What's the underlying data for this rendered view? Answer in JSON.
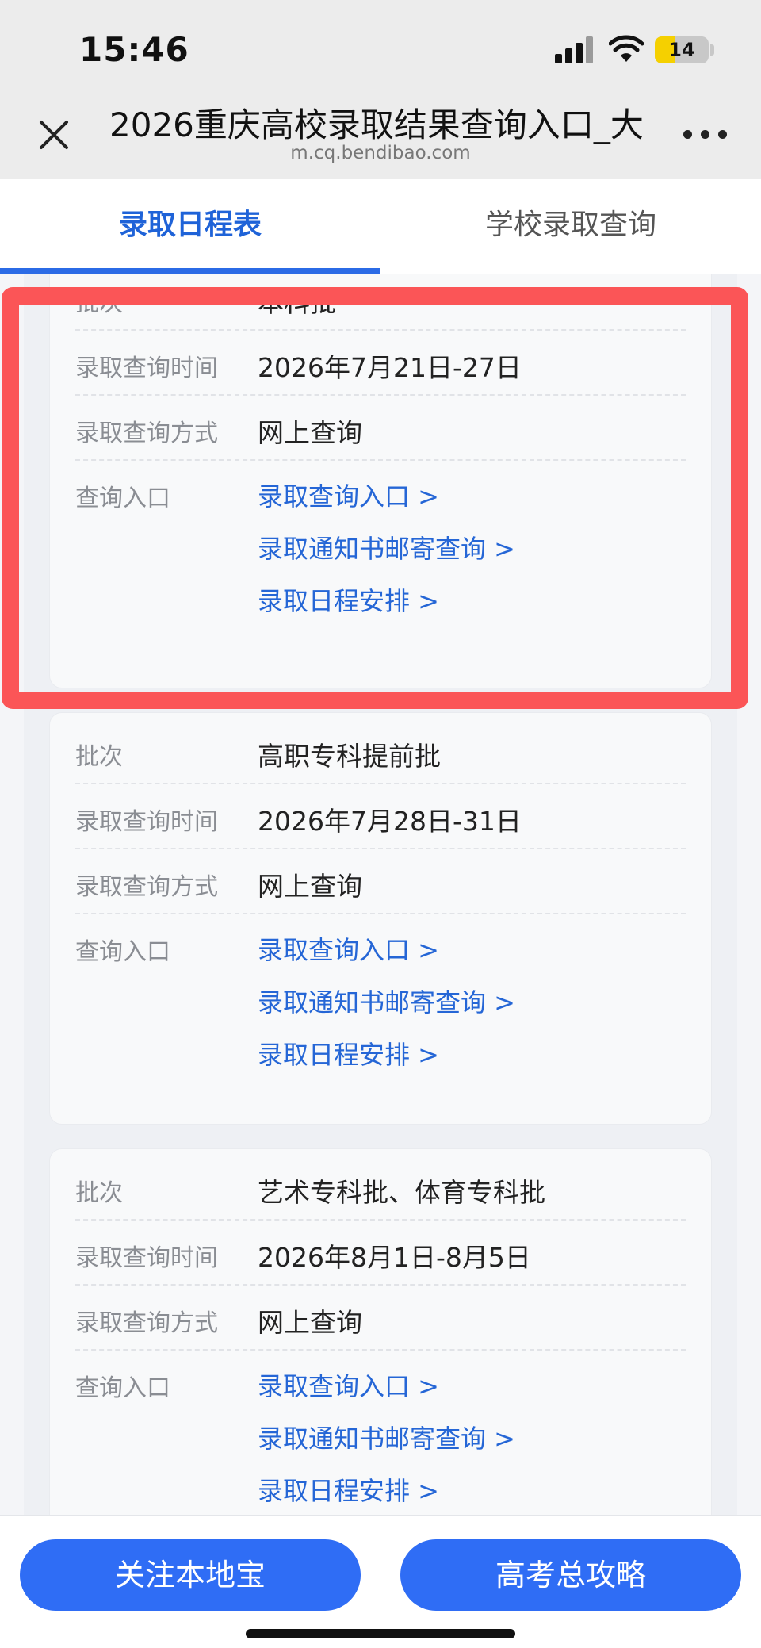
{
  "status_bar": {
    "time": "15:46",
    "battery": "14"
  },
  "browser": {
    "title": "2026重庆高校录取结果查询入口_大",
    "url": "m.cq.bendibao.com"
  },
  "tabs": [
    {
      "label": "录取日程表",
      "active": true
    },
    {
      "label": "学校录取查询",
      "active": false
    }
  ],
  "cards": [
    {
      "batch_label": "批次",
      "batch": "本科批",
      "time_label": "录取查询时间",
      "time": "2026年7月21日-27日",
      "method_label": "录取查询方式",
      "method": "网上查询",
      "entry_label": "查询入口",
      "links": [
        "录取查询入口 >",
        "录取通知书邮寄查询 >",
        "录取日程安排 >"
      ]
    },
    {
      "batch_label": "批次",
      "batch": "高职专科提前批",
      "time_label": "录取查询时间",
      "time": "2026年7月28日-31日",
      "method_label": "录取查询方式",
      "method": "网上查询",
      "entry_label": "查询入口",
      "links": [
        "录取查询入口 >",
        "录取通知书邮寄查询 >",
        "录取日程安排 >"
      ]
    },
    {
      "batch_label": "批次",
      "batch": "艺术专科批、体育专科批",
      "time_label": "录取查询时间",
      "time": "2026年8月1日-8月5日",
      "method_label": "录取查询方式",
      "method": "网上查询",
      "entry_label": "查询入口",
      "links": [
        "录取查询入口 >",
        "录取通知书邮寄查询 >",
        "录取日程安排 >"
      ]
    }
  ],
  "bottom_bar": {
    "follow_label": "关注本地宝",
    "guide_label": "高考总攻略"
  },
  "colors": {
    "accent": "#2f6df5",
    "link": "#2566d6",
    "highlight": "#fb5557",
    "battery": "#f5d000"
  }
}
